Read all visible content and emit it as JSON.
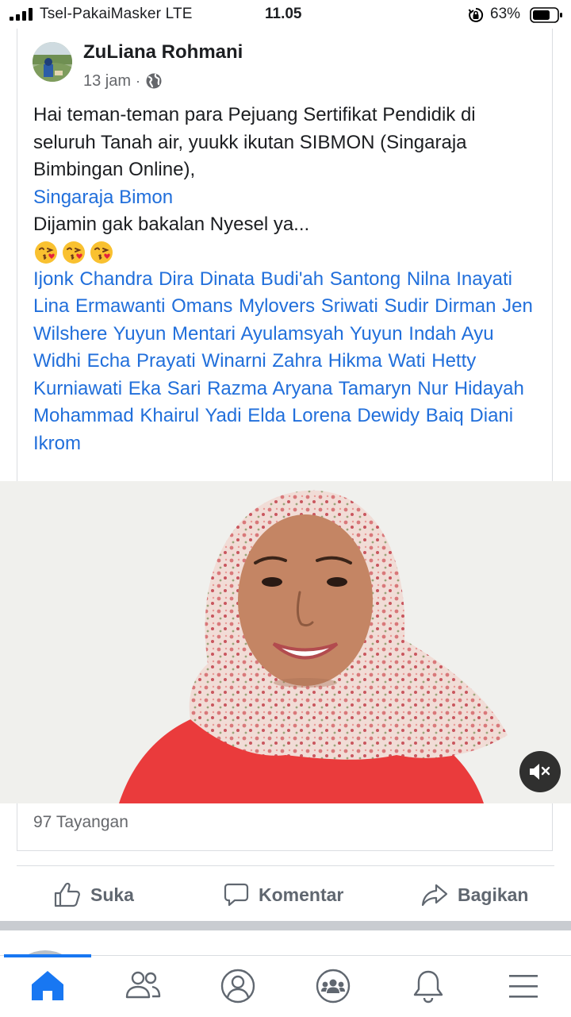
{
  "status_bar": {
    "carrier": "Tsel-PakaiMasker  LTE",
    "time": "11.05",
    "battery_percent": "63%",
    "icons": [
      "signal-icon",
      "lock-rotation-icon",
      "battery-icon"
    ]
  },
  "post": {
    "author": "ZuLiana Rohmani",
    "time_ago": "13 jam",
    "separator": "·",
    "privacy_icon": "globe-icon",
    "text_line_1": "Hai teman-teman  para Pejuang Sertifikat Pendidik di seluruh Tanah air, yuukk ikutan SIBMON (Singaraja Bimbingan Online),",
    "mention_link": "Singaraja Bimon",
    "text_line_2": "Dijamin gak bakalan Nyesel ya...",
    "emojis": [
      "kissing-heart-emoji",
      "kissing-heart-emoji",
      "kissing-heart-emoji"
    ],
    "tagged_people": "Ijonk Chandra Dira Dinata  Budi'ah Santong  Nilna Inayati  Lina Ermawanti  Omans Mylovers  Sriwati Sudir Dirman  Jen Wilshere Yuyun Mentari Ayulamsyah Yuyun Indah Ayu Widhi  Echa Prayati Winarni Zahra Hikma Wati Hetty Kurniawati Eka Sari Razma Aryana Tamaryn Nur Hidayah Mohammad Khairul Yadi Elda Lorena Dewidy Baiq Diani Ikrom",
    "views": "97 Tayangan",
    "mute_icon": "volume-muted-icon"
  },
  "actions": {
    "like": "Suka",
    "comment": "Komentar",
    "share": "Bagikan"
  },
  "bottom_nav": {
    "items": [
      "home-icon",
      "friends-icon",
      "profile-icon",
      "groups-icon",
      "notifications-icon",
      "menu-icon"
    ],
    "active": "home-icon"
  },
  "colors": {
    "link": "#216fdb",
    "active_nav": "#1877f2",
    "secondary_text": "#65676b",
    "action_text": "#606770"
  }
}
